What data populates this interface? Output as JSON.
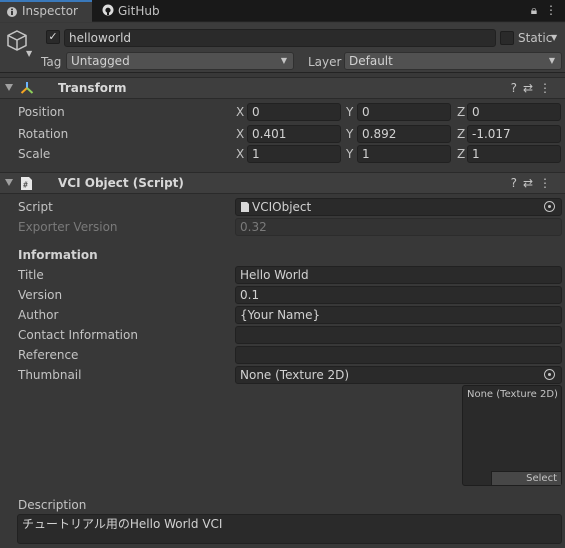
{
  "tabs": {
    "inspector": "Inspector",
    "github": "GitHub"
  },
  "object": {
    "name": "helloworld",
    "static_label": "Static",
    "tag_label": "Tag",
    "tag_value": "Untagged",
    "layer_label": "Layer",
    "layer_value": "Default"
  },
  "transform": {
    "title": "Transform",
    "rows": [
      {
        "label": "Position",
        "x": "0",
        "y": "0",
        "z": "0"
      },
      {
        "label": "Rotation",
        "x": "0.401",
        "y": "0.892",
        "z": "-1.017"
      },
      {
        "label": "Scale",
        "x": "1",
        "y": "1",
        "z": "1"
      }
    ],
    "axis": {
      "x": "X",
      "y": "Y",
      "z": "Z"
    }
  },
  "vci": {
    "title": "VCI Object (Script)",
    "script_label": "Script",
    "script_value": "VCIObject",
    "exporter_label": "Exporter Version",
    "exporter_value": "0.32",
    "info_header": "Information",
    "title_label": "Title",
    "title_value": "Hello World",
    "version_label": "Version",
    "version_value": "0.1",
    "author_label": "Author",
    "author_value": "{Your Name}",
    "contact_label": "Contact Information",
    "contact_value": "",
    "reference_label": "Reference",
    "reference_value": "",
    "thumbnail_label": "Thumbnail",
    "thumbnail_value": "None (Texture 2D)",
    "thumbnail_box_text": "None (Texture 2D)",
    "select_label": "Select",
    "description_label": "Description",
    "description_value": "チュートリアル用のHello World VCI"
  },
  "icons": {
    "lock": "lock-icon",
    "menu": "kebab-menu-icon",
    "help": "help-icon",
    "preset": "preset-icon"
  },
  "colors": {
    "background": "#383838",
    "tab_active_accent": "#3a79bb",
    "field_bg": "#2a2a2a"
  }
}
